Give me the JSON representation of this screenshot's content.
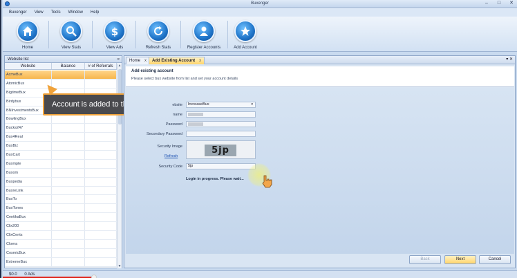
{
  "window": {
    "title": "Buxenger"
  },
  "menu": [
    "Buxenger",
    "View",
    "Tools",
    "Window",
    "Help"
  ],
  "toolbar": [
    {
      "label": "Home",
      "icon": "home-icon"
    },
    {
      "label": "View Stats",
      "icon": "magnifier-icon"
    },
    {
      "label": "View Ads",
      "icon": "dollar-icon"
    },
    {
      "label": "Refresh Stats",
      "icon": "refresh-icon"
    },
    {
      "label": "Register Accounts",
      "icon": "user-icon"
    },
    {
      "label": "Add Account",
      "icon": "star-icon"
    }
  ],
  "website_list": {
    "title": "Website list",
    "columns": [
      "Website",
      "Balance",
      "# of Referrals"
    ],
    "rows": [
      "AcmeBux",
      "AtomicBux",
      "BigtimeBux",
      "Birdybux",
      "BNInvestmentsBux",
      "BowlingBux",
      "Bucks247",
      "Bux4Real",
      "BuxBiz",
      "BuxCart",
      "Buxmple",
      "Buxom",
      "Buxpedia",
      "BuxreLink",
      "BuxTo",
      "BuxTones",
      "CentikaBux",
      "Clix200",
      "ClixCents",
      "Cloera",
      "CosmicBux",
      "ExtremeBux"
    ],
    "selected_index": 0
  },
  "tooltip": {
    "text": "Account is added to the list"
  },
  "tabs": [
    {
      "label": "Home",
      "close": "x"
    },
    {
      "label": "Add Existing Account",
      "close": "x"
    }
  ],
  "tab_controls": "▾ ✕",
  "header": {
    "title": "Add existing account",
    "subtitle": "Please select bux website from list and set your account details"
  },
  "form": {
    "website_label": "ebsite",
    "website_value": "IncreaseBux",
    "username_label": "name",
    "password_label": "Password",
    "secondary_password_label": "Secondary Password",
    "security_image_label": "Security Image",
    "refresh_label": "Refresh",
    "captcha_text": "5jp",
    "security_code_label": "Security Code",
    "security_code_value": "5jp",
    "status": "Login in progress. Please wait..."
  },
  "buttons": {
    "back": "Back",
    "next": "Next",
    "cancel": "Cancel"
  },
  "statusbar": {
    "balance": "$0.0",
    "ads": "0 Ads"
  }
}
